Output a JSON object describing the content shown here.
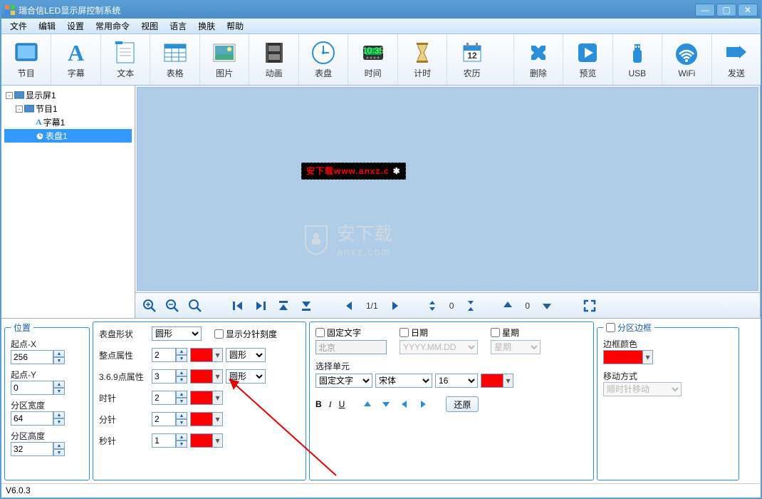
{
  "app_title": "瑞合信LED显示屏控制系统",
  "menu": [
    "文件",
    "编辑",
    "设置",
    "常用命令",
    "视图",
    "语言",
    "换肤",
    "帮助"
  ],
  "toolbar": [
    {
      "label": "节目",
      "icon": "program"
    },
    {
      "label": "字幕",
      "icon": "A"
    },
    {
      "label": "文本",
      "icon": "notepad"
    },
    {
      "label": "表格",
      "icon": "table"
    },
    {
      "label": "图片",
      "icon": "image"
    },
    {
      "label": "动画",
      "icon": "film"
    },
    {
      "label": "表盘",
      "icon": "clock"
    },
    {
      "label": "时间",
      "icon": "digital"
    },
    {
      "label": "计时",
      "icon": "hourglass"
    },
    {
      "label": "农历",
      "icon": "calendar"
    },
    {
      "label": "删除",
      "icon": "delete"
    },
    {
      "label": "预览",
      "icon": "play"
    },
    {
      "label": "USB",
      "icon": "usb"
    },
    {
      "label": "WiFi",
      "icon": "wifi"
    },
    {
      "label": "发送",
      "icon": "send"
    }
  ],
  "tree": {
    "root": "显示屏1",
    "program": "节目1",
    "items": [
      "字幕1",
      "表盘1"
    ],
    "selected": "表盘1"
  },
  "preview_text": "安下载www.anxz.c",
  "watermark_text": "安下载",
  "watermark_sub": "anxz.com",
  "nav": {
    "page": "1/1",
    "val1": "0",
    "val2": "0"
  },
  "position": {
    "legend": "位置",
    "labels": {
      "x": "起点-X",
      "y": "起点-Y",
      "w": "分区宽度",
      "h": "分区高度"
    },
    "x": "256",
    "y": "0",
    "w": "64",
    "h": "32"
  },
  "dial": {
    "shape_label": "表盘形状",
    "shape": "圆形",
    "tick_chk": "显示分针刻度",
    "rows": [
      {
        "label": "整点属性",
        "num": "2",
        "shape": "圆形"
      },
      {
        "label": "3.6.9点属性",
        "num": "3",
        "shape": "圆形"
      },
      {
        "label": "时针",
        "num": "2"
      },
      {
        "label": "分针",
        "num": "2"
      },
      {
        "label": "秒针",
        "num": "1"
      }
    ]
  },
  "textpanel": {
    "fixed_chk": "固定文字",
    "fixed_val": "北京",
    "date_chk": "日期",
    "date_fmt": "YYYY.MM.DD",
    "week_chk": "星期",
    "week_val": "星期",
    "select_label": "选择单元",
    "unit": "固定文字",
    "font": "宋体",
    "size": "16",
    "restore": "还原"
  },
  "border": {
    "chk": "分区边框",
    "color_label": "边框颜色",
    "move_label": "移动方式",
    "move_val": "顺时针移动"
  },
  "status": "V6.0.3"
}
